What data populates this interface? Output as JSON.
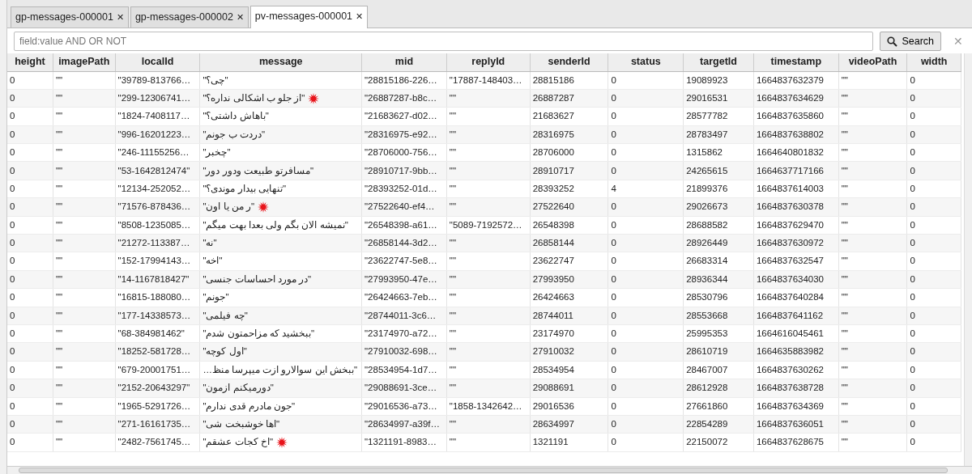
{
  "tabs": [
    {
      "label": "gp-messages-000001",
      "close": "✕",
      "selected": false
    },
    {
      "label": "gp-messages-000002",
      "close": "✕",
      "selected": false
    },
    {
      "label": "pv-messages-000001",
      "close": "✕",
      "selected": true
    }
  ],
  "search": {
    "placeholder": "field:value AND OR NOT",
    "button": "Search",
    "clear": "✕"
  },
  "table": {
    "columns": [
      "height",
      "imagePath",
      "localId",
      "message",
      "mid",
      "replyId",
      "senderId",
      "status",
      "targetId",
      "timestamp",
      "videoPath",
      "width"
    ],
    "rows": [
      {
        "censored": false,
        "cells": [
          "0",
          "\"\"",
          "\"39789-813766…",
          "\"چی؟\"",
          "\"28815186-226…",
          "\"17887-148403…",
          "28815186",
          "0",
          "19089923",
          "1664837632379",
          "\"\"",
          "0"
        ]
      },
      {
        "censored": true,
        "cells": [
          "0",
          "\"\"",
          "\"299-12306741…",
          "\"از جلو ب اشکالی نداره؟\"",
          "\"26887287-b8c…",
          "\"\"",
          "26887287",
          "0",
          "29016531",
          "1664837634629",
          "\"\"",
          "0"
        ]
      },
      {
        "censored": false,
        "cells": [
          "0",
          "\"\"",
          "\"1824-7408117…",
          "\"باهاش داشتی؟\"",
          "\"21683627-d02…",
          "\"\"",
          "21683627",
          "0",
          "28577782",
          "1664837635860",
          "\"\"",
          "0"
        ]
      },
      {
        "censored": false,
        "cells": [
          "0",
          "\"\"",
          "\"996-16201223…",
          "\"دردت ب جونم\"",
          "\"28316975-e92…",
          "\"\"",
          "28316975",
          "0",
          "28783497",
          "1664837638802",
          "\"\"",
          "0"
        ]
      },
      {
        "censored": false,
        "cells": [
          "0",
          "\"\"",
          "\"246-11155256…",
          "\"چخبر\"",
          "\"28706000-756…",
          "\"\"",
          "28706000",
          "0",
          "1315862",
          "1664640801832",
          "\"\"",
          "0"
        ]
      },
      {
        "censored": false,
        "cells": [
          "0",
          "\"\"",
          "\"53-1642812474\"",
          "\"مسافرتو طبیعت ودور دور\"",
          "\"28910717-9bb…",
          "\"\"",
          "28910717",
          "0",
          "24265615",
          "1664637717166",
          "\"\"",
          "0"
        ]
      },
      {
        "censored": false,
        "cells": [
          "0",
          "\"\"",
          "\"12134-252052…",
          "\"تنهایی بیدار موندی؟\"",
          "\"28393252-01d…",
          "\"\"",
          "28393252",
          "4",
          "21899376",
          "1664837614003",
          "\"\"",
          "0"
        ]
      },
      {
        "censored": true,
        "cells": [
          "0",
          "\"\"",
          "\"71576-878436…",
          "\"ر من یا اون\"",
          "\"27522640-ef4…",
          "\"\"",
          "27522640",
          "0",
          "29026673",
          "1664837630378",
          "\"\"",
          "0"
        ]
      },
      {
        "censored": false,
        "cells": [
          "0",
          "\"\"",
          "\"8508-1235085…",
          "\"نمیشه الان بگم ولی بعدا بهت میگم\"",
          "\"26548398-a61…",
          "\"5089-7192572…",
          "26548398",
          "0",
          "28688582",
          "1664837629470",
          "\"\"",
          "0"
        ]
      },
      {
        "censored": false,
        "cells": [
          "0",
          "\"\"",
          "\"21272-113387…",
          "\"نه\"",
          "\"26858144-3d2…",
          "\"\"",
          "26858144",
          "0",
          "28926449",
          "1664837630972",
          "\"\"",
          "0"
        ]
      },
      {
        "censored": false,
        "cells": [
          "0",
          "\"\"",
          "\"152-17994143…",
          "\"اخه\"",
          "\"23622747-5e8…",
          "\"\"",
          "23622747",
          "0",
          "26683314",
          "1664837632547",
          "\"\"",
          "0"
        ]
      },
      {
        "censored": false,
        "cells": [
          "0",
          "\"\"",
          "\"14-1167818427\"",
          "\"در مورد احساسات جنسی\"",
          "\"27993950-47e…",
          "\"\"",
          "27993950",
          "0",
          "28936344",
          "1664837634030",
          "\"\"",
          "0"
        ]
      },
      {
        "censored": false,
        "cells": [
          "0",
          "\"\"",
          "\"16815-188080…",
          "\"جونم\"",
          "\"26424663-7eb…",
          "\"\"",
          "26424663",
          "0",
          "28530796",
          "1664837640284",
          "\"\"",
          "0"
        ]
      },
      {
        "censored": false,
        "cells": [
          "0",
          "\"\"",
          "\"177-14338573…",
          "\"چه فیلمی\"",
          "\"28744011-3c6…",
          "\"\"",
          "28744011",
          "0",
          "28553668",
          "1664837641162",
          "\"\"",
          "0"
        ]
      },
      {
        "censored": false,
        "cells": [
          "0",
          "\"\"",
          "\"68-384981462\"",
          "\"ببخشید که مزاحمتون شدم\"",
          "\"23174970-a72…",
          "\"\"",
          "23174970",
          "0",
          "25995353",
          "1664616045461",
          "\"\"",
          "0"
        ]
      },
      {
        "censored": false,
        "cells": [
          "0",
          "\"\"",
          "\"18252-581728…",
          "\"اول کوچه\"",
          "\"27910032-698…",
          "\"\"",
          "27910032",
          "0",
          "28610719",
          "1664635883982",
          "\"\"",
          "0"
        ]
      },
      {
        "censored": false,
        "cells": [
          "0",
          "\"\"",
          "\"679-20001751…",
          "\"ببخش این سوالارو ازت میپرسا منظ…",
          "\"28534954-1d7…",
          "\"\"",
          "28534954",
          "0",
          "28467007",
          "1664837630262",
          "\"\"",
          "0"
        ]
      },
      {
        "censored": false,
        "cells": [
          "0",
          "\"\"",
          "\"2152-20643297\"",
          "\"دورمیکنم ازمون\"",
          "\"29088691-3ce…",
          "\"\"",
          "29088691",
          "0",
          "28612928",
          "1664837638728",
          "\"\"",
          "0"
        ]
      },
      {
        "censored": false,
        "cells": [
          "0",
          "\"\"",
          "\"1965-5291726…",
          "\"جون مادرم قدی ندارم\"",
          "\"29016536-a73…",
          "\"1858-1342642…",
          "29016536",
          "0",
          "27661860",
          "1664837634369",
          "\"\"",
          "0"
        ]
      },
      {
        "censored": false,
        "cells": [
          "0",
          "\"\"",
          "\"271-16161735…",
          "\"اها خوشبخت شی\"",
          "\"28634997-a39f…",
          "\"\"",
          "28634997",
          "0",
          "22854289",
          "1664837636051",
          "\"\"",
          "0"
        ]
      },
      {
        "censored": true,
        "cells": [
          "0",
          "\"\"",
          "\"2482-7561745…",
          "\"اخ کجات عشقم\"",
          "\"1321191-8983…",
          "\"\"",
          "1321191",
          "0",
          "22150072",
          "1664837628675",
          "\"\"",
          "0"
        ]
      }
    ]
  }
}
